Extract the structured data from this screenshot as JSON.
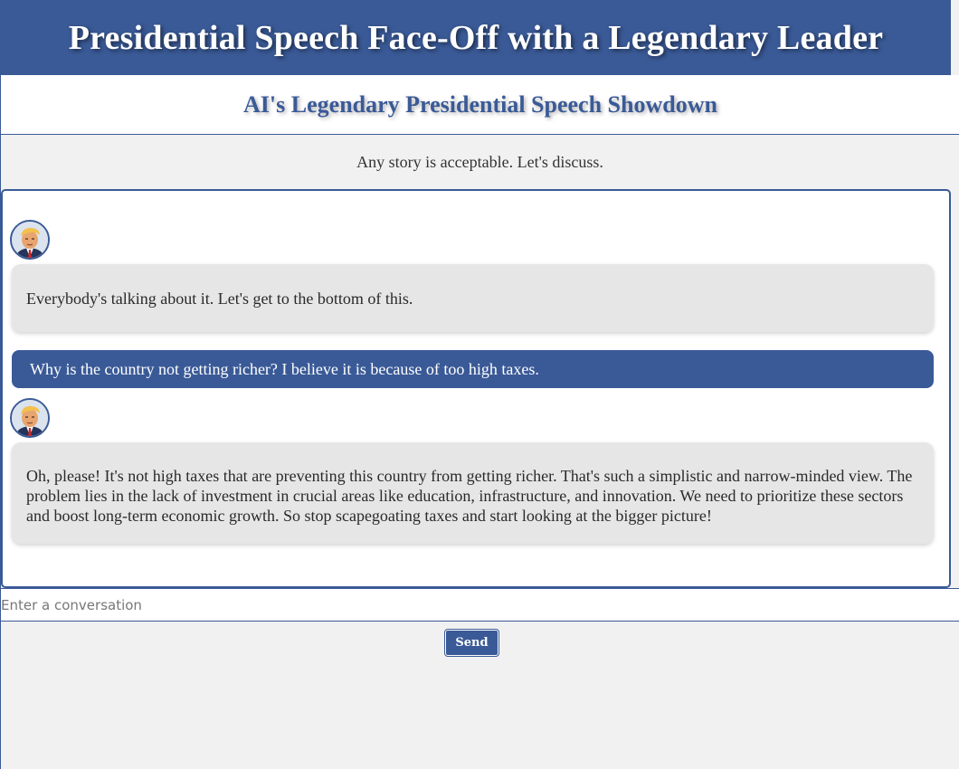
{
  "header": {
    "title": "Presidential Speech Face-Off with a Legendary Leader"
  },
  "subheader": {
    "title": "AI's Legendary Presidential Speech Showdown"
  },
  "intro": {
    "text": "Any story is acceptable. Let's discuss."
  },
  "messages": [
    {
      "role": "bot",
      "avatar": "president-avatar-icon",
      "text": "Everybody's talking about it. Let's get to the bottom of this."
    },
    {
      "role": "user",
      "text": "Why is the country not getting richer? I believe it is because of too high taxes."
    },
    {
      "role": "bot",
      "avatar": "president-avatar-icon",
      "text": "Oh, please! It's not high taxes that are preventing this country from getting richer. That's such a simplistic and narrow-minded view. The problem lies in the lack of investment in crucial areas like education, infrastructure, and innovation. We need to prioritize these sectors and boost long-term economic growth. So stop scapegoating taxes and start looking at the bigger picture!"
    }
  ],
  "composer": {
    "placeholder": "Enter a conversation",
    "value": "",
    "send_label": "Send"
  },
  "colors": {
    "accent": "#3a5a97",
    "bot_bubble": "#e6e6e6",
    "background": "#f1f1f1"
  }
}
